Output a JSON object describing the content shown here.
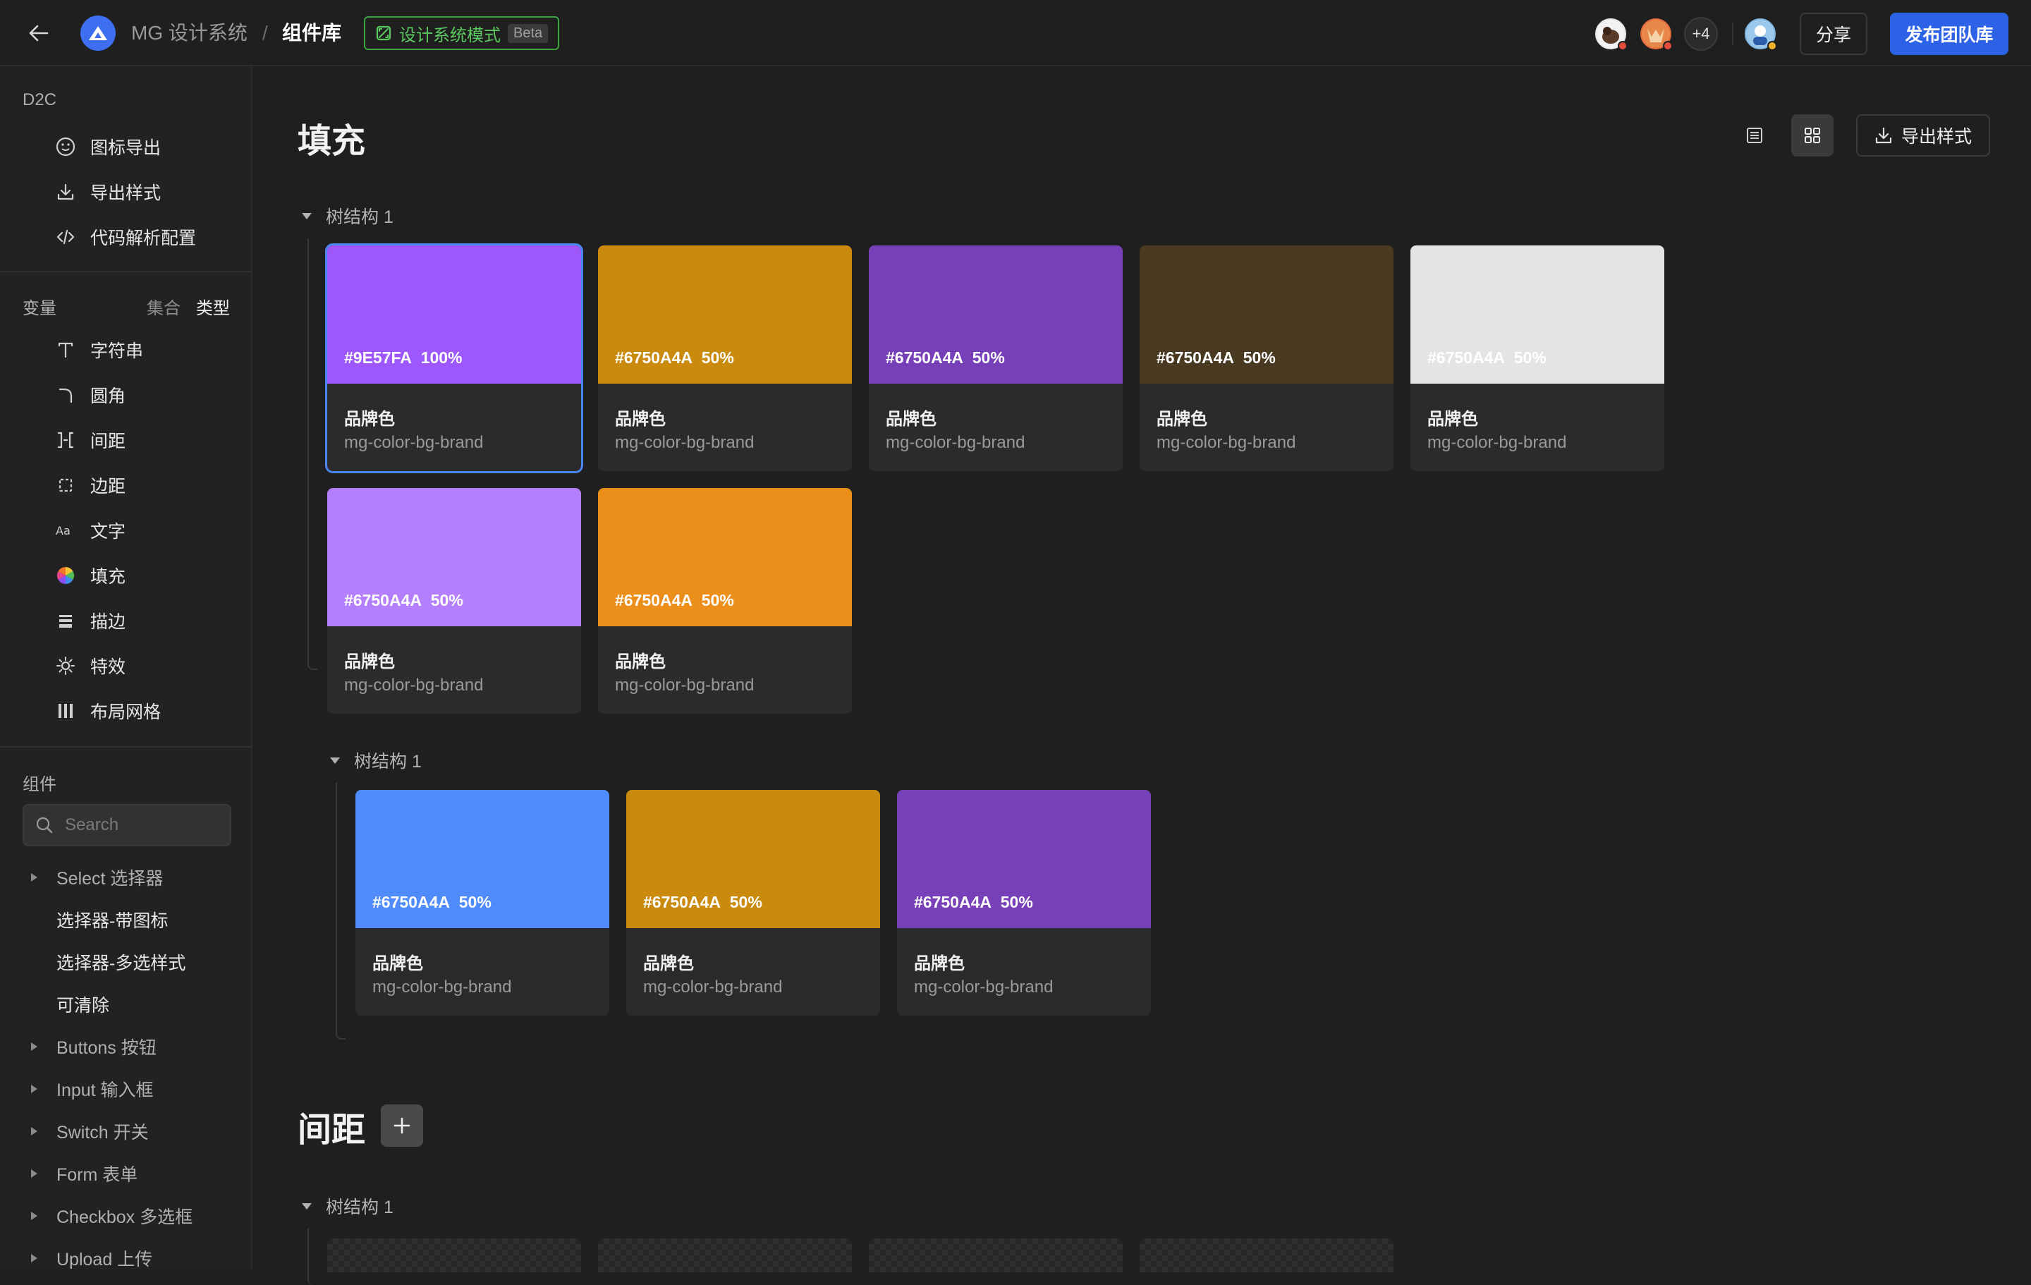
{
  "header": {
    "project": "MG 设计系统",
    "separator": "/",
    "current_page": "组件库",
    "mode_label": "设计系统模式",
    "beta_label": "Beta",
    "more_users": "+4",
    "share_label": "分享",
    "publish_label": "发布团队库"
  },
  "sidebar": {
    "d2c_title": "D2C",
    "d2c_items": [
      {
        "label": "图标导出",
        "icon": "smiley-icon"
      },
      {
        "label": "导出样式",
        "icon": "download-icon"
      },
      {
        "label": "代码解析配置",
        "icon": "code-icon"
      }
    ],
    "vars_title": "变量",
    "vars_toggle": {
      "set": "集合",
      "type": "类型"
    },
    "var_items": [
      {
        "label": "字符串",
        "icon": "text-icon"
      },
      {
        "label": "圆角",
        "icon": "corner-radius-icon"
      },
      {
        "label": "间距",
        "icon": "spacing-icon"
      },
      {
        "label": "边距",
        "icon": "padding-icon"
      },
      {
        "label": "文字",
        "icon": "typography-icon"
      },
      {
        "label": "填充",
        "icon": "color-wheel-icon"
      },
      {
        "label": "描边",
        "icon": "stroke-icon"
      },
      {
        "label": "特效",
        "icon": "effect-icon"
      },
      {
        "label": "布局网格",
        "icon": "layout-grid-icon"
      }
    ],
    "components_title": "组件",
    "search_placeholder": "Search",
    "tree": [
      {
        "label": "Select 选择器",
        "kind": "parent"
      },
      {
        "label": "选择器-带图标",
        "kind": "child"
      },
      {
        "label": "选择器-多选样式",
        "kind": "child"
      },
      {
        "label": "可清除",
        "kind": "child"
      },
      {
        "label": "Buttons 按钮",
        "kind": "parent"
      },
      {
        "label": "Input 输入框",
        "kind": "parent"
      },
      {
        "label": "Switch 开关",
        "kind": "parent"
      },
      {
        "label": "Form 表单",
        "kind": "parent"
      },
      {
        "label": "Checkbox 多选框",
        "kind": "parent"
      },
      {
        "label": "Upload 上传",
        "kind": "parent"
      }
    ]
  },
  "main": {
    "fill_title": "填充",
    "export_label": "导出样式",
    "group1_label": "树结构 1",
    "group2_label": "树结构 1",
    "spacing_title": "间距",
    "group3_label": "树结构 1",
    "group1_cards": [
      {
        "hex": "#9E57FA",
        "opacity": "100%",
        "name": "品牌色",
        "token": "mg-color-bg-brand",
        "color": "#9e57fa"
      },
      {
        "hex": "#6750A4A",
        "opacity": "50%",
        "name": "品牌色",
        "token": "mg-color-bg-brand",
        "color": "#c98a0e"
      },
      {
        "hex": "#6750A4A",
        "opacity": "50%",
        "name": "品牌色",
        "token": "mg-color-bg-brand",
        "color": "#7840b8"
      },
      {
        "hex": "#6750A4A",
        "opacity": "50%",
        "name": "品牌色",
        "token": "mg-color-bg-brand",
        "color": "#493920"
      },
      {
        "hex": "#6750A4A",
        "opacity": "50%",
        "name": "品牌色",
        "token": "mg-color-bg-brand",
        "color": "#e4e4e4"
      },
      {
        "hex": "#6750A4A",
        "opacity": "50%",
        "name": "品牌色",
        "token": "mg-color-bg-brand",
        "color": "#b47ffc"
      },
      {
        "hex": "#6750A4A",
        "opacity": "50%",
        "name": "品牌色",
        "token": "mg-color-bg-brand",
        "color": "#ec8e1a"
      }
    ],
    "group2_cards": [
      {
        "hex": "#6750A4A",
        "opacity": "50%",
        "name": "品牌色",
        "token": "mg-color-bg-brand",
        "color": "#4f8bfa"
      },
      {
        "hex": "#6750A4A",
        "opacity": "50%",
        "name": "品牌色",
        "token": "mg-color-bg-brand",
        "color": "#c98a0e"
      },
      {
        "hex": "#6750A4A",
        "opacity": "50%",
        "name": "品牌色",
        "token": "mg-color-bg-brand",
        "color": "#7840b8"
      }
    ]
  }
}
